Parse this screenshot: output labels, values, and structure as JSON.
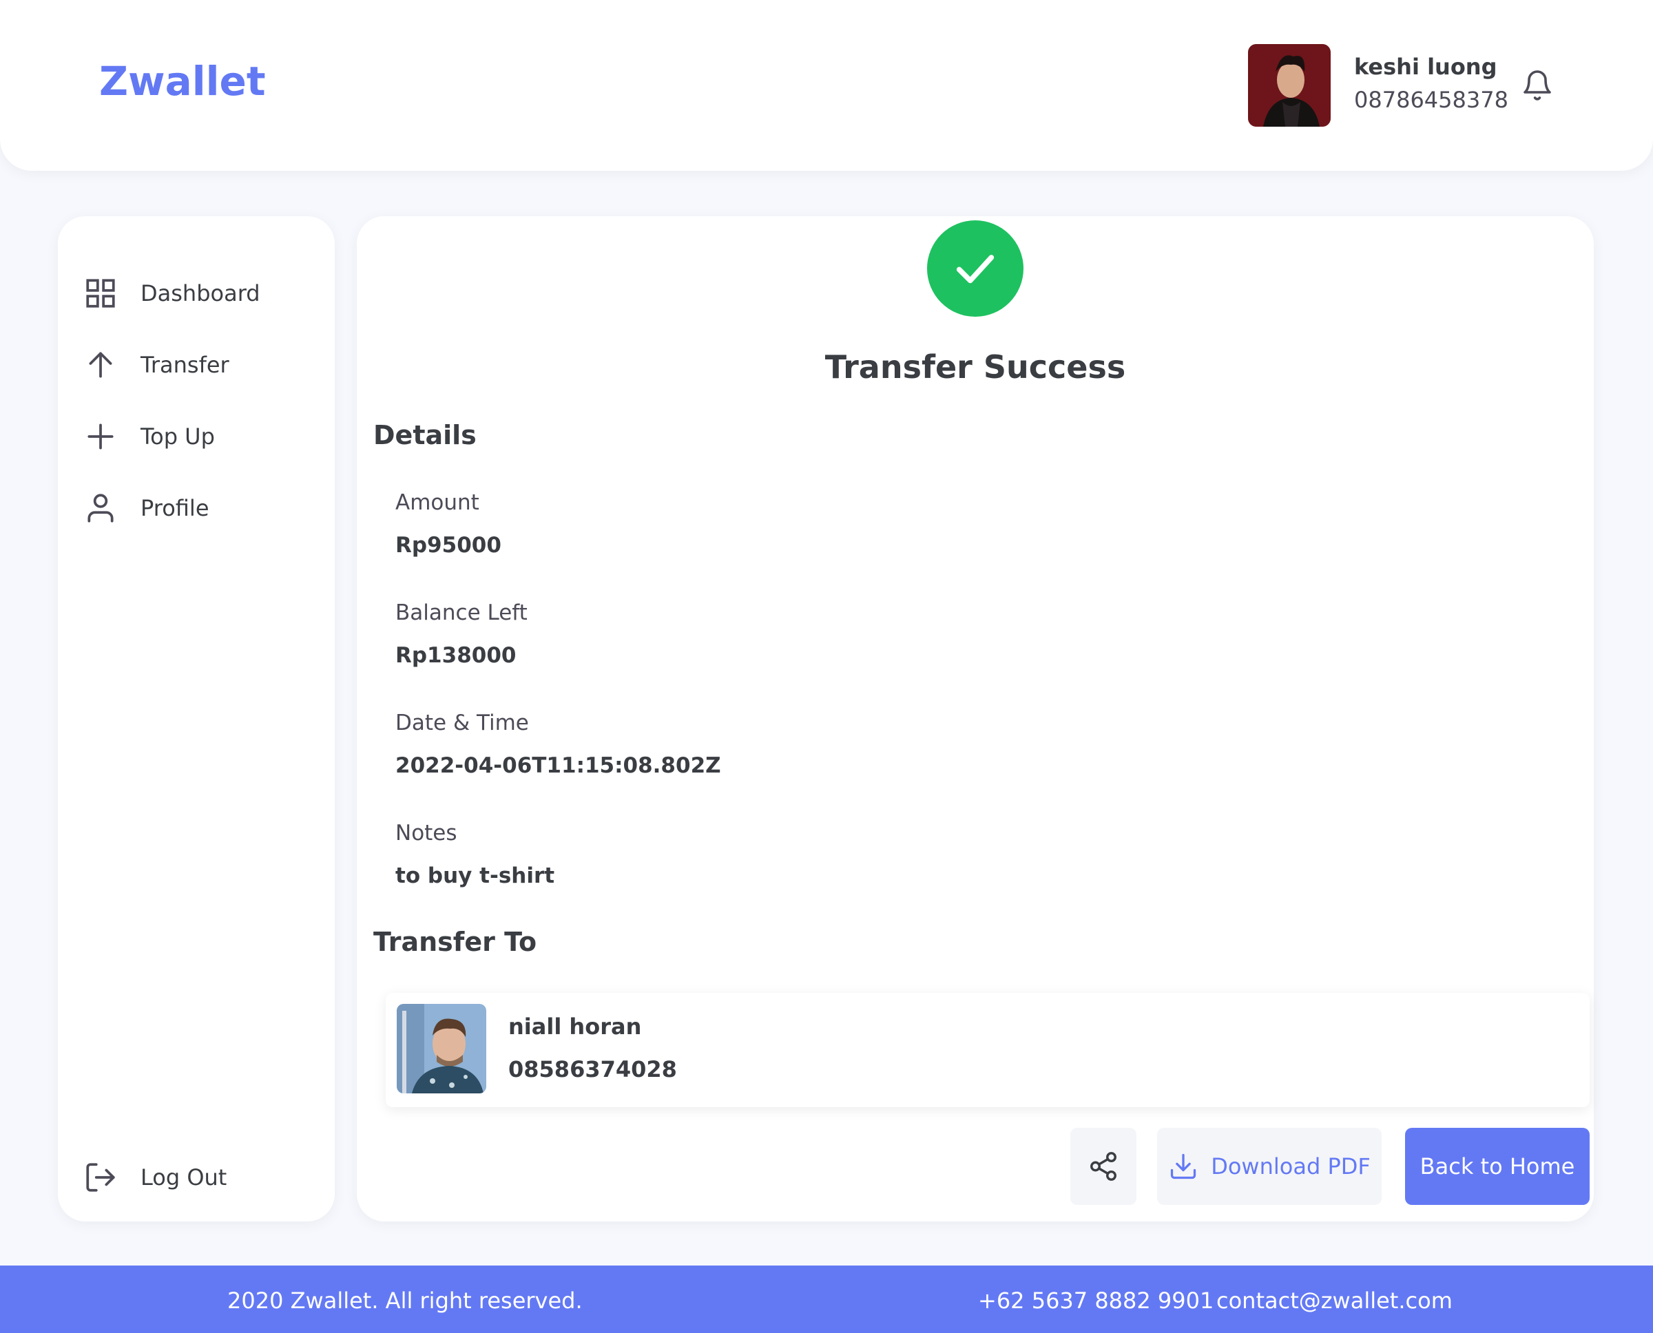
{
  "header": {
    "logo": "Zwallet",
    "user": {
      "name": "keshi luong",
      "phone": "08786458378",
      "avatar": "user-avatar-photo"
    },
    "notification_icon": "bell-icon"
  },
  "sidebar": {
    "items": [
      {
        "label": "Dashboard",
        "icon": "grid-icon"
      },
      {
        "label": "Transfer",
        "icon": "arrow-up-icon"
      },
      {
        "label": "Top Up",
        "icon": "plus-icon"
      },
      {
        "label": "Profile",
        "icon": "user-icon"
      }
    ],
    "logout": {
      "label": "Log Out",
      "icon": "logout-icon"
    }
  },
  "main": {
    "status_icon": "check-circle-icon",
    "title": "Transfer Success",
    "details_title": "Details",
    "details": [
      {
        "label": "Amount",
        "value": "Rp95000"
      },
      {
        "label": "Balance Left",
        "value": "Rp138000"
      },
      {
        "label": "Date & Time",
        "value": "2022-04-06T11:15:08.802Z"
      },
      {
        "label": "Notes",
        "value": "to buy t-shirt"
      }
    ],
    "transfer_to_title": "Transfer To",
    "recipient": {
      "name": "niall horan",
      "phone": "08586374028",
      "avatar": "recipient-avatar-photo"
    },
    "actions": {
      "share_icon": "share-icon",
      "download_label": "Download PDF",
      "download_icon": "download-icon",
      "home_label": "Back to Home"
    }
  },
  "footer": {
    "copyright": "2020 Zwallet. All right reserved.",
    "phone": "+62 5637 8882 9901",
    "email": "contact@zwallet.com"
  },
  "colors": {
    "accent": "#6379f4",
    "success": "#1ec15f",
    "background": "#f6f8fd",
    "text": "#3a3d42"
  }
}
